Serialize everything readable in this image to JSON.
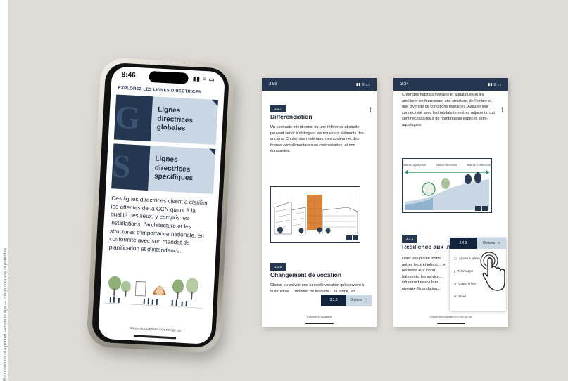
{
  "credit": "Reproduction of a printed sample image — Image courtesy of publisher",
  "phone1": {
    "time": "8:46",
    "signal": "▮▮ ≡ ▭",
    "heading": "EXPLOREZ LES LIGNES DIRECTRICES",
    "card1": {
      "letter": "G",
      "label_line1": "Lignes directrices",
      "label_line2": "globales"
    },
    "card2": {
      "letter": "S",
      "label_line1": "Lignes directrices",
      "label_line2": "spécifiques"
    },
    "paragraph": "Ces lignes directrices visent à clarifier les attentes de la CCN quant à la qualité des lieux, y compris les installations, l'architecture et les structures d'importance nationale, en conformité avec son mandat de planification et d'intendance.",
    "url": "conceptioncapitale.ccn-ncc.gc.ca"
  },
  "screen2": {
    "time": "2:59",
    "badge1": "3.1.7",
    "title1": "Différenciation",
    "body1": "Un contraste intentionnel ou une référence abstraite peuvent servir à distinguer les nouveaux éléments des anciens. Choisir des matériaux, des couleurs et des formes complémentaires ou contrastantes, et non écrasantes.",
    "badge2": "3.1.8",
    "title2": "Changement de vocation",
    "body2": "Choisir ou prévoir une nouvelle vocation qui convient à la structure ... modifier de manière ... la forme, les ...",
    "toolbar_code": "3.1.8",
    "toolbar_options": "Options",
    "translation": "Translation Available"
  },
  "screen3": {
    "time": "3:34",
    "body_top": "Créer des habitats riverains et aquatiques et les améliorer en fournissant une structure, de l'ombre et une diversité de conditions riveraines. Assurer leur connectivité avec les habitats terrestres adjacents, qui sont nécessaires à de nombreuses espèces semi-aquatiques.",
    "diagram_labels": [
      "HABITAT AQUATIQUE",
      "HABITAT RIVERAIN",
      "HABITAT TERRESTRE"
    ],
    "badge": "2.4.3",
    "title": "Résilience aux in",
    "body_bottom": "Dans une plaine inond... autres lieux et infrastr... et résilients aux inond... bâtiments, les service... infrastructures vulnér... niveaux d'inondation...",
    "menu": {
      "code": "2.4.3",
      "options": "Options",
      "close": "×",
      "items": [
        "Ajouter à la liste",
        "Télécharger",
        "Copier le lien",
        "Email"
      ]
    },
    "url": "conceptioncapitale.ccn-ncc.gc.ca"
  }
}
